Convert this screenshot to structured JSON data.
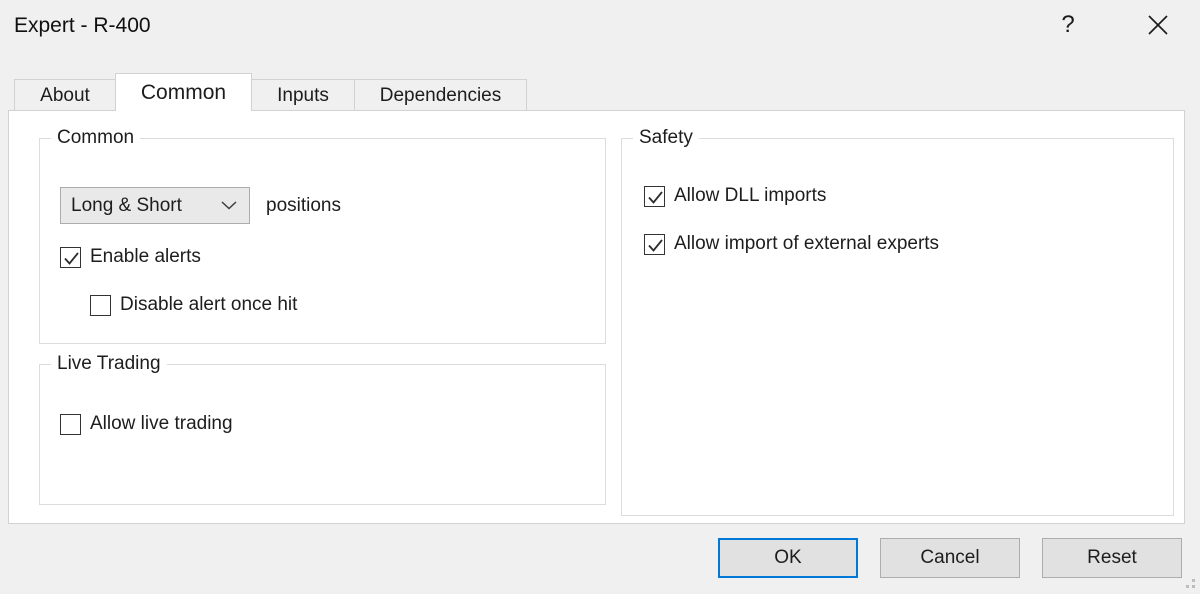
{
  "window": {
    "title": "Expert - R-400",
    "help_glyph": "?",
    "help_name": "help-icon",
    "close_name": "close-icon"
  },
  "tabs": [
    {
      "label": "About",
      "selected": false
    },
    {
      "label": "Common",
      "selected": true
    },
    {
      "label": "Inputs",
      "selected": false
    },
    {
      "label": "Dependencies",
      "selected": false
    }
  ],
  "common_group": {
    "title": "Common",
    "positions": {
      "selected": "Long & Short",
      "label": "positions",
      "options": [
        "Long & Short"
      ]
    },
    "checkboxes": [
      {
        "label": "Enable alerts",
        "checked": true
      },
      {
        "label": "Disable alert once hit",
        "checked": false
      }
    ]
  },
  "live_trading_group": {
    "title": "Live Trading",
    "checkboxes": [
      {
        "label": "Allow live trading",
        "checked": false
      }
    ]
  },
  "safety_group": {
    "title": "Safety",
    "checkboxes": [
      {
        "label": "Allow DLL imports",
        "checked": true
      },
      {
        "label": "Allow import of external experts",
        "checked": true
      }
    ]
  },
  "buttons": {
    "ok": "OK",
    "cancel": "Cancel",
    "reset": "Reset"
  },
  "colors": {
    "focus_border": "#0078d7",
    "dialog_bg": "#f0f0f0",
    "panel_bg": "#ffffff",
    "group_border": "#dcdcdc",
    "button_face": "#e1e1e1"
  }
}
